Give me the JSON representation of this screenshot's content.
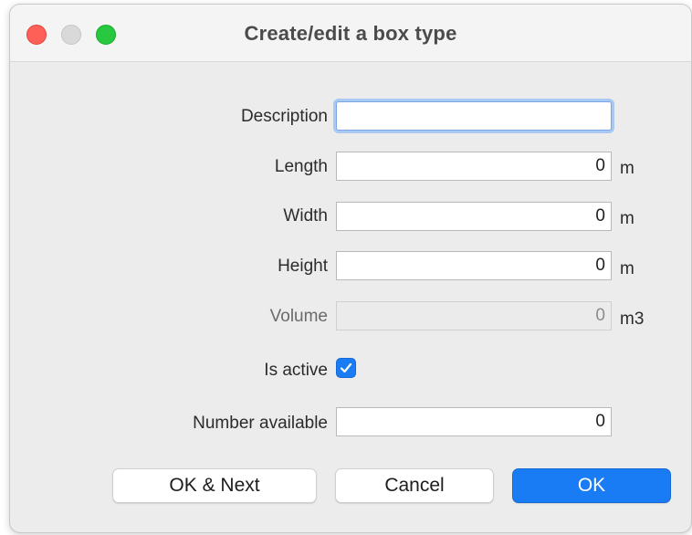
{
  "window": {
    "title": "Create/edit a box type"
  },
  "form": {
    "description": {
      "label": "Description",
      "value": ""
    },
    "length": {
      "label": "Length",
      "value": "0",
      "unit": "m"
    },
    "width": {
      "label": "Width",
      "value": "0",
      "unit": "m"
    },
    "height": {
      "label": "Height",
      "value": "0",
      "unit": "m"
    },
    "volume": {
      "label": "Volume",
      "value": "0",
      "unit": "m3"
    },
    "is_active": {
      "label": "Is active",
      "checked": true
    },
    "number_available": {
      "label": "Number available",
      "value": "0"
    }
  },
  "buttons": {
    "ok_next": "OK & Next",
    "cancel": "Cancel",
    "ok": "OK"
  },
  "colors": {
    "accent": "#1a7cf5",
    "close": "#fe5f57",
    "minimize": "#d9d9d9",
    "zoom": "#28c840"
  }
}
